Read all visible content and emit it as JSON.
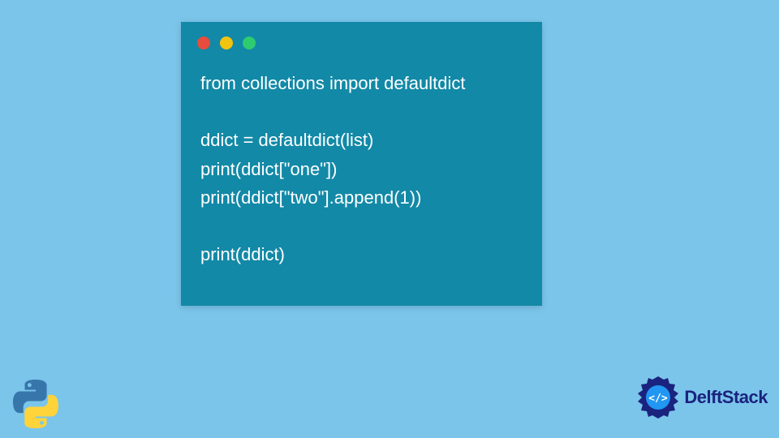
{
  "code": {
    "line1": "from collections import defaultdict",
    "line2": "",
    "line3": "ddict = defaultdict(list)",
    "line4": "print(ddict[\"one\"])",
    "line5": "print(ddict[\"two\"].append(1))",
    "line6": "",
    "line7": "print(ddict)"
  },
  "brand": {
    "name": "DelftStack"
  },
  "colors": {
    "background": "#7bc5eb",
    "window": "#1289a7",
    "text": "#ffffff",
    "brand_text": "#1a237e",
    "dot_red": "#e74c3c",
    "dot_yellow": "#f1c40f",
    "dot_green": "#2ecc71"
  }
}
